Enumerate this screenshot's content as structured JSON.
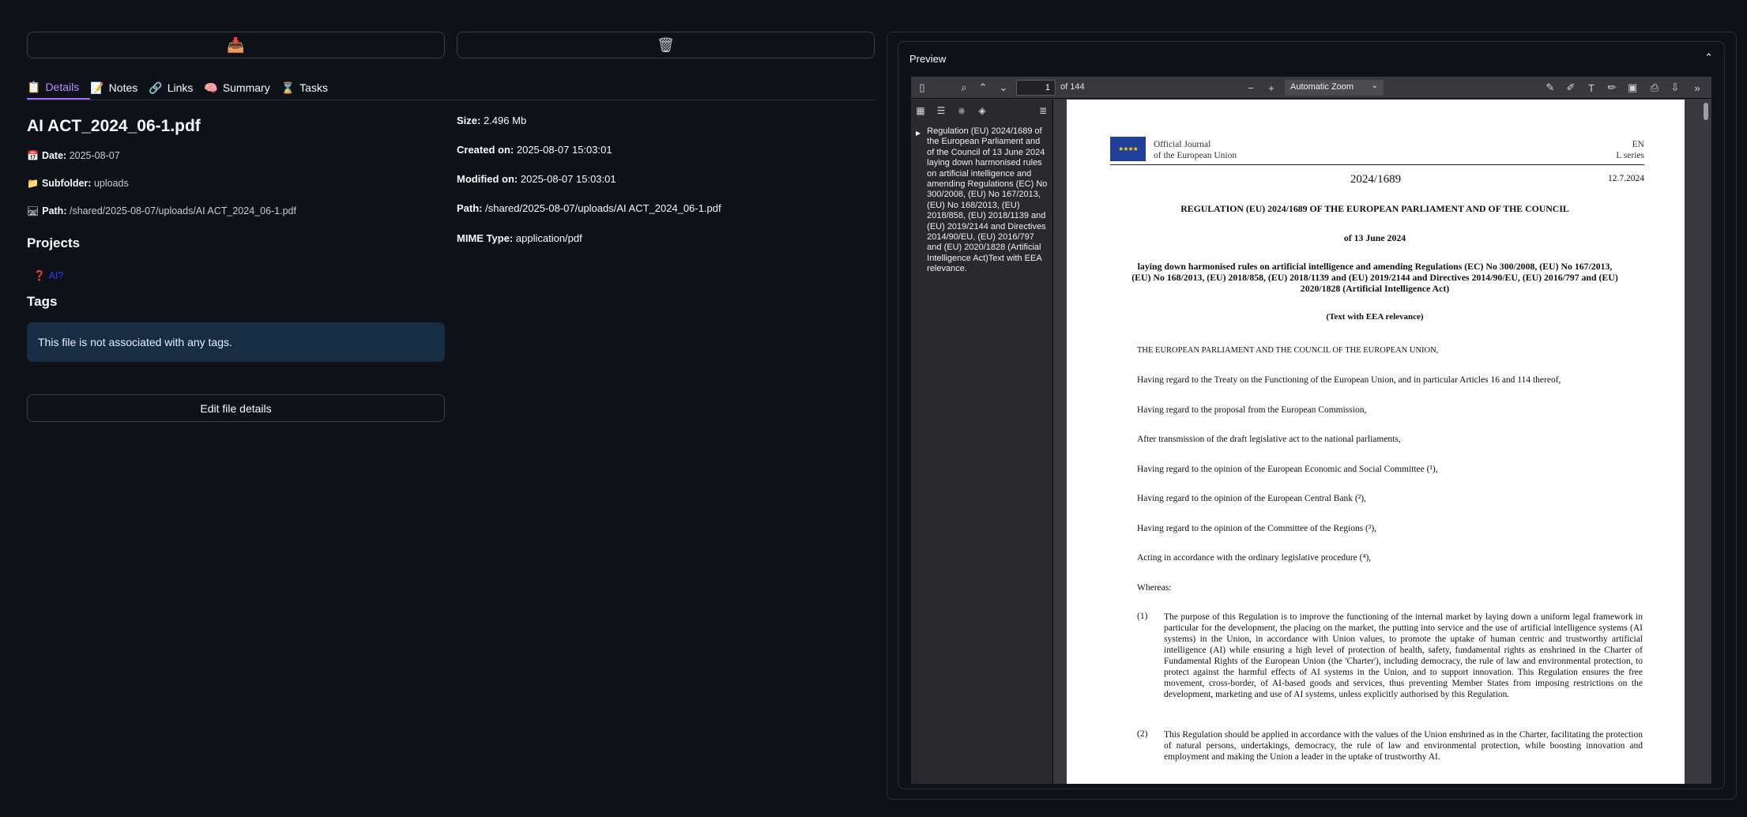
{
  "actions": {
    "download_icon": "📥",
    "delete_icon": "🗑"
  },
  "tabs": [
    {
      "icon": "📋",
      "label": "Details"
    },
    {
      "icon": "📝",
      "label": "Notes"
    },
    {
      "icon": "🔗",
      "label": "Links"
    },
    {
      "icon": "🧠",
      "label": "Summary"
    },
    {
      "icon": "⌛",
      "label": "Tasks"
    }
  ],
  "file": {
    "name": "AI ACT_2024_06-1.pdf",
    "date_label": "Date:",
    "date": "2025-08-07",
    "subfolder_label": "Subfolder:",
    "subfolder": "uploads",
    "path_label": "Path:",
    "path": "/shared/2025-08-07/uploads/AI ACT_2024_06-1.pdf"
  },
  "projects": {
    "heading": "Projects",
    "items": [
      {
        "icon": "❓",
        "name": "AI?"
      }
    ]
  },
  "tags": {
    "heading": "Tags",
    "empty_message": "This file is not associated with any tags."
  },
  "edit_button": "Edit file details",
  "properties": {
    "size_label": "Size:",
    "size": "2.496 Mb",
    "created_label": "Created on:",
    "created": "2025-08-07 15:03:01",
    "modified_label": "Modified on:",
    "modified": "2025-08-07 15:03:01",
    "path_label": "Path:",
    "path": "/shared/2025-08-07/uploads/AI ACT_2024_06-1.pdf",
    "mime_label": "MIME Type:",
    "mime": "application/pdf"
  },
  "preview": {
    "heading": "Preview",
    "page_number": "1",
    "page_total": "of 144",
    "zoom": "Automatic Zoom",
    "outline_item": "Regulation (EU) 2024/1689 of the European Parliament and of the Council of 13 June 2024 laying down harmonised rules on artificial intelligence and amending Regulations (EC) No 300/2008, (EU) No 167/2013, (EU) No 168/2013, (EU) 2018/858, (EU) 2018/1139 and (EU) 2019/2144 and Directives 2014/90/EU, (EU) 2016/797 and (EU) 2020/1828 (Artificial Intelligence Act)Text with EEA relevance."
  },
  "document": {
    "journal_line1": "Official Journal",
    "journal_line2": "of the European Union",
    "lang": "EN",
    "series": "L series",
    "reg_number": "2024/1689",
    "reg_date": "12.7.2024",
    "heading": "REGULATION (EU) 2024/1689 OF THE EUROPEAN PARLIAMENT AND OF THE COUNCIL",
    "of_date": "of 13 June 2024",
    "subject": "laying down harmonised rules on artificial intelligence and amending Regulations (EC) No 300/2008, (EU) No 167/2013, (EU) No 168/2013, (EU) 2018/858, (EU) 2018/1139 and (EU) 2019/2144 and Directives 2014/90/EU, (EU) 2016/797 and (EU) 2020/1828 (Artificial Intelligence Act)",
    "eea": "(Text with EEA relevance)",
    "preamble": [
      "THE EUROPEAN PARLIAMENT AND THE COUNCIL OF THE EUROPEAN UNION,",
      "Having regard to the Treaty on the Functioning of the European Union, and in particular Articles 16 and 114 thereof,",
      "Having regard to the proposal from the European Commission,",
      "After transmission of the draft legislative act to the national parliaments,",
      "Having regard to the opinion of the European Economic and Social Committee (¹),",
      "Having regard to the opinion of the European Central Bank (²),",
      "Having regard to the opinion of the Committee of the Regions (³),",
      "Acting in accordance with the ordinary legislative procedure (⁴),",
      "Whereas:"
    ],
    "recitals": [
      {
        "num": "(1)",
        "text": "The purpose of this Regulation is to improve the functioning of the internal market by laying down a uniform legal framework in particular for the development, the placing on the market, the putting into service and the use of artificial intelligence systems (AI systems) in the Union, in accordance with Union values, to promote the uptake of human centric and trustworthy artificial intelligence (AI) while ensuring a high level of protection of health, safety, fundamental rights as enshrined in the Charter of Fundamental Rights of the European Union (the 'Charter'), including democracy, the rule of law and environmental protection, to protect against the harmful effects of AI systems in the Union, and to support innovation. This Regulation ensures the free movement, cross-border, of AI-based goods and services, thus preventing Member States from imposing restrictions on the development, marketing and use of AI systems, unless explicitly authorised by this Regulation."
      },
      {
        "num": "(2)",
        "text": "This Regulation should be applied in accordance with the values of the Union enshrined as in the Charter, facilitating the protection of natural persons, undertakings, democracy, the rule of law and environmental protection, while boosting innovation and employment and making the Union a leader in the uptake of trustworthy AI."
      }
    ]
  }
}
